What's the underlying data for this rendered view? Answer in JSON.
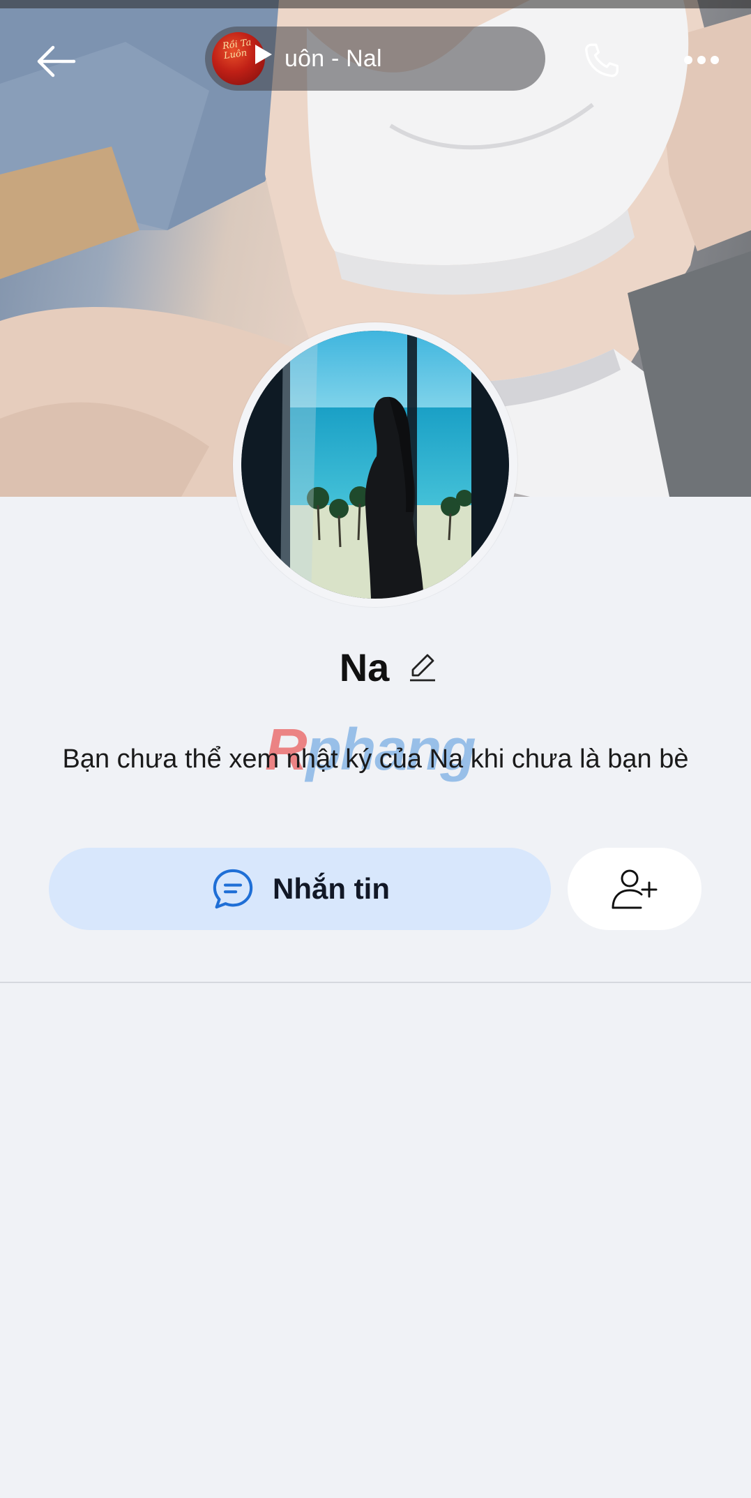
{
  "header": {
    "music_title": "uôn - Nal",
    "music_thumb_text": "Rồi Ta Luôn",
    "back_icon": "arrow-left-icon",
    "call_icon": "phone-icon",
    "more_icon": "more-horizontal-icon"
  },
  "profile": {
    "name": "Na",
    "edit_icon": "pencil-icon"
  },
  "watermark": {
    "first": "R",
    "rest": "phang"
  },
  "info": {
    "message": "Bạn chưa thể xem nhật ký của Na khi chưa là bạn bè"
  },
  "actions": {
    "message_label": "Nhắn tin",
    "message_icon": "chat-bubble-icon",
    "add_friend_icon": "add-user-icon"
  },
  "colors": {
    "background": "#f0f2f6",
    "message_button_bg": "#d8e7fc",
    "accent_blue": "#1f6fd6"
  }
}
